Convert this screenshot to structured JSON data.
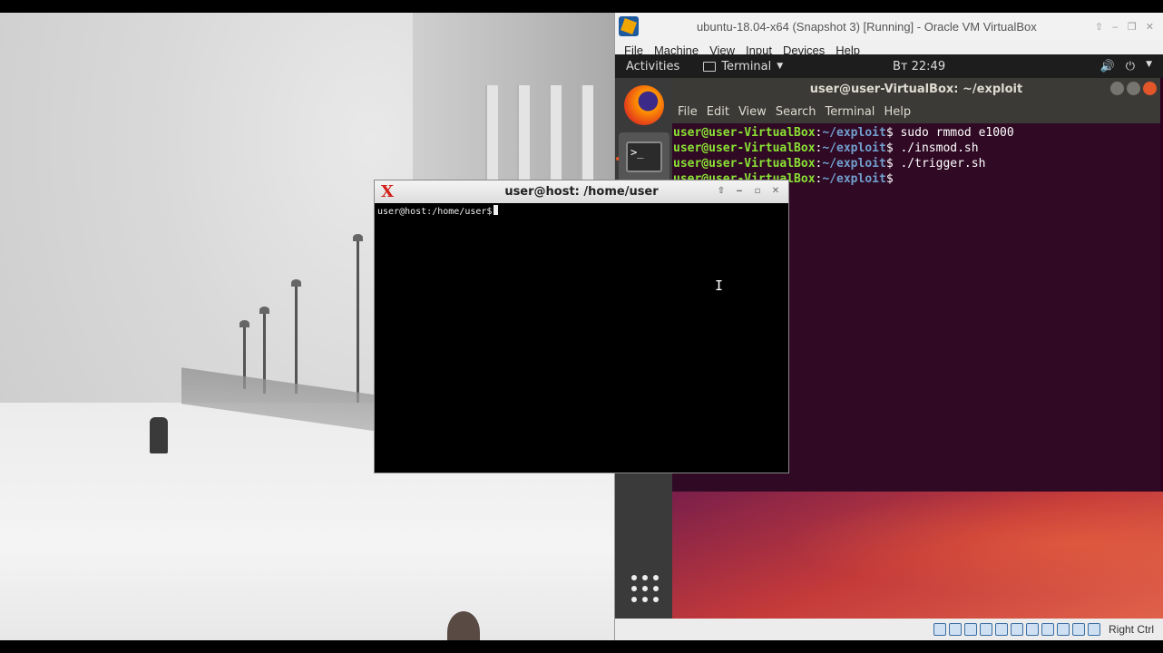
{
  "vbox": {
    "title": "ubuntu-18.04-x64 (Snapshot 3) [Running] - Oracle VM VirtualBox",
    "menu": [
      "File",
      "Machine",
      "View",
      "Input",
      "Devices",
      "Help"
    ],
    "host_key_label": "Right Ctrl",
    "status_icons": [
      "hard-disk-icon",
      "optical-drive-icon",
      "audio-icon",
      "network-icon",
      "usb-icon",
      "shared-folders-icon",
      "display-icon",
      "video-capture-icon",
      "virtualization-icon",
      "mouse-integration-icon",
      "keyboard-icon"
    ]
  },
  "gnome": {
    "activities": "Activities",
    "app_name": "Terminal",
    "clock": "Вт 22:49"
  },
  "guest_terminal": {
    "title": "user@user-VirtualBox: ~/exploit",
    "menu": [
      "File",
      "Edit",
      "View",
      "Search",
      "Terminal",
      "Help"
    ],
    "prompt_user": "user@user-VirtualBox",
    "prompt_path": "~/exploit",
    "lines": [
      {
        "cmd": " sudo rmmod e1000"
      },
      {
        "cmd": " ./insmod.sh"
      },
      {
        "cmd": " ./trigger.sh"
      },
      {
        "cmd": ""
      }
    ]
  },
  "host_terminal": {
    "title": "user@host: /home/user",
    "prompt": "user@host:/home/user$"
  },
  "colors": {
    "ubuntu_terminal_bg": "#300a24",
    "prompt_green": "#8ae234",
    "prompt_blue": "#729fcf",
    "ubuntu_orange": "#e95420"
  }
}
